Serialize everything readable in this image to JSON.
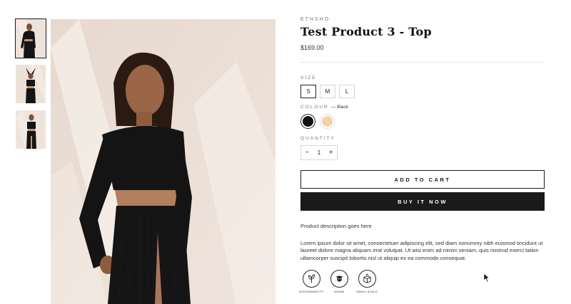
{
  "product": {
    "vendor": "ETHSHO",
    "title": "Test Product 3 - Top",
    "price": "$169.00"
  },
  "options": {
    "size_label": "SIZE",
    "sizes": [
      "S",
      "M",
      "L"
    ],
    "selected_size": "S",
    "colour_label": "COLOUR",
    "colour_selected": "— Black",
    "colours": [
      {
        "name": "Black",
        "hex": "#111111"
      },
      {
        "name": "Beige",
        "hex": "#f2d2a6"
      }
    ],
    "quantity_label": "QUANTITY",
    "quantity_minus": "−",
    "quantity_value": "1",
    "quantity_plus": "+"
  },
  "actions": {
    "add_to_cart": "ADD TO CART",
    "buy_now": "BUY IT NOW"
  },
  "description": {
    "heading": "Product description goes here",
    "body": "Lorem ipsum dolor sit amet, consectetuer adipiscing elit, sed diam nonummy nibh euismod tincidunt ut laoreet dolore magna aliquam erat volutpat. Ut wisi enim ad minim veniam, quis nostrud exerci tation ullamcorper suscipit lobortis nisl ut aliquip ex ea commodo consequat."
  },
  "badges": [
    {
      "label": "SUSTAINABILITY",
      "icon": "leaf-icon"
    },
    {
      "label": "VEGAN",
      "icon": "cow-icon"
    },
    {
      "label": "SMALL SCALE",
      "icon": "box-icon"
    }
  ],
  "colors": {
    "text": "#1a1a1a",
    "accent": "#1a1a1a",
    "photo_bg": "#efe6df"
  }
}
